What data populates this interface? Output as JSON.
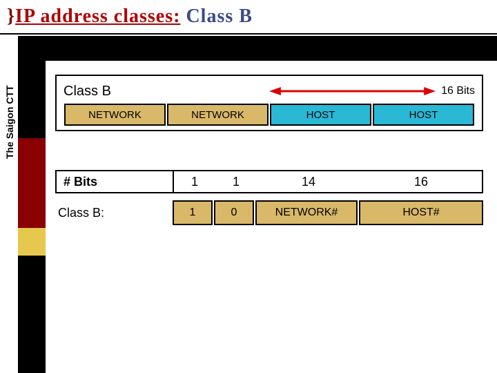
{
  "title": {
    "brace": "}",
    "red_underline": "IP address classes:",
    "blue": "Class B"
  },
  "sidebar": {
    "vertical_text": "The Saigon CTT"
  },
  "diagram": {
    "class_label": "Class B",
    "arrow_bits_label": "16 Bits",
    "octets": [
      {
        "label": "NETWORK",
        "color": "tan"
      },
      {
        "label": "NETWORK",
        "color": "tan"
      },
      {
        "label": "HOST",
        "color": "blue"
      },
      {
        "label": "HOST",
        "color": "blue"
      }
    ],
    "bits_table": {
      "row_label": "# Bits",
      "values": [
        "1",
        "1",
        "14",
        "16"
      ]
    },
    "breakdown": {
      "row_label": "Class B:",
      "cells": [
        "1",
        "0",
        "NETWORK#",
        "HOST#"
      ]
    }
  }
}
